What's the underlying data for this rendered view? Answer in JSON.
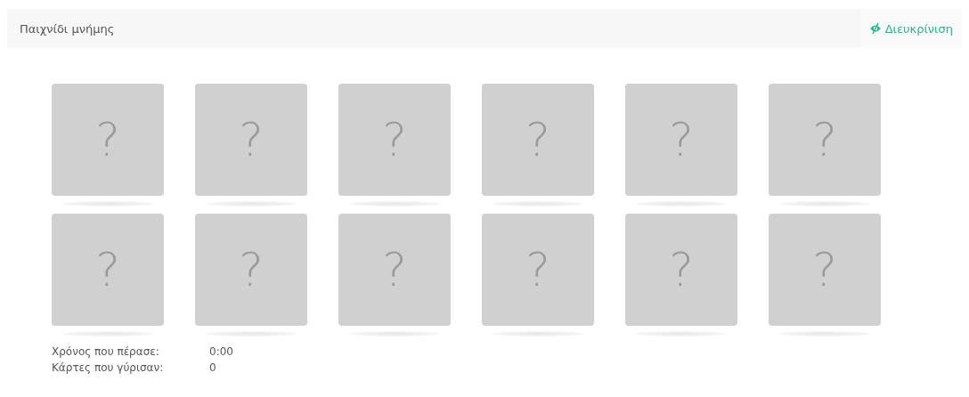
{
  "header": {
    "title": "Παιχνίδι μνήμης",
    "help_button": "Διευκρίνιση"
  },
  "card_rows": [
    [
      {
        "label": "?"
      },
      {
        "label": "?"
      },
      {
        "label": "?"
      },
      {
        "label": "?"
      },
      {
        "label": "?"
      },
      {
        "label": "?"
      }
    ],
    [
      {
        "label": "?"
      },
      {
        "label": "?"
      },
      {
        "label": "?"
      },
      {
        "label": "?"
      },
      {
        "label": "?"
      },
      {
        "label": "?"
      }
    ]
  ],
  "stats": [
    {
      "label": "Χρόνος που πέρασε:",
      "value": "0:00"
    },
    {
      "label": "Κάρτες που γύρισαν:",
      "value": "0"
    }
  ]
}
